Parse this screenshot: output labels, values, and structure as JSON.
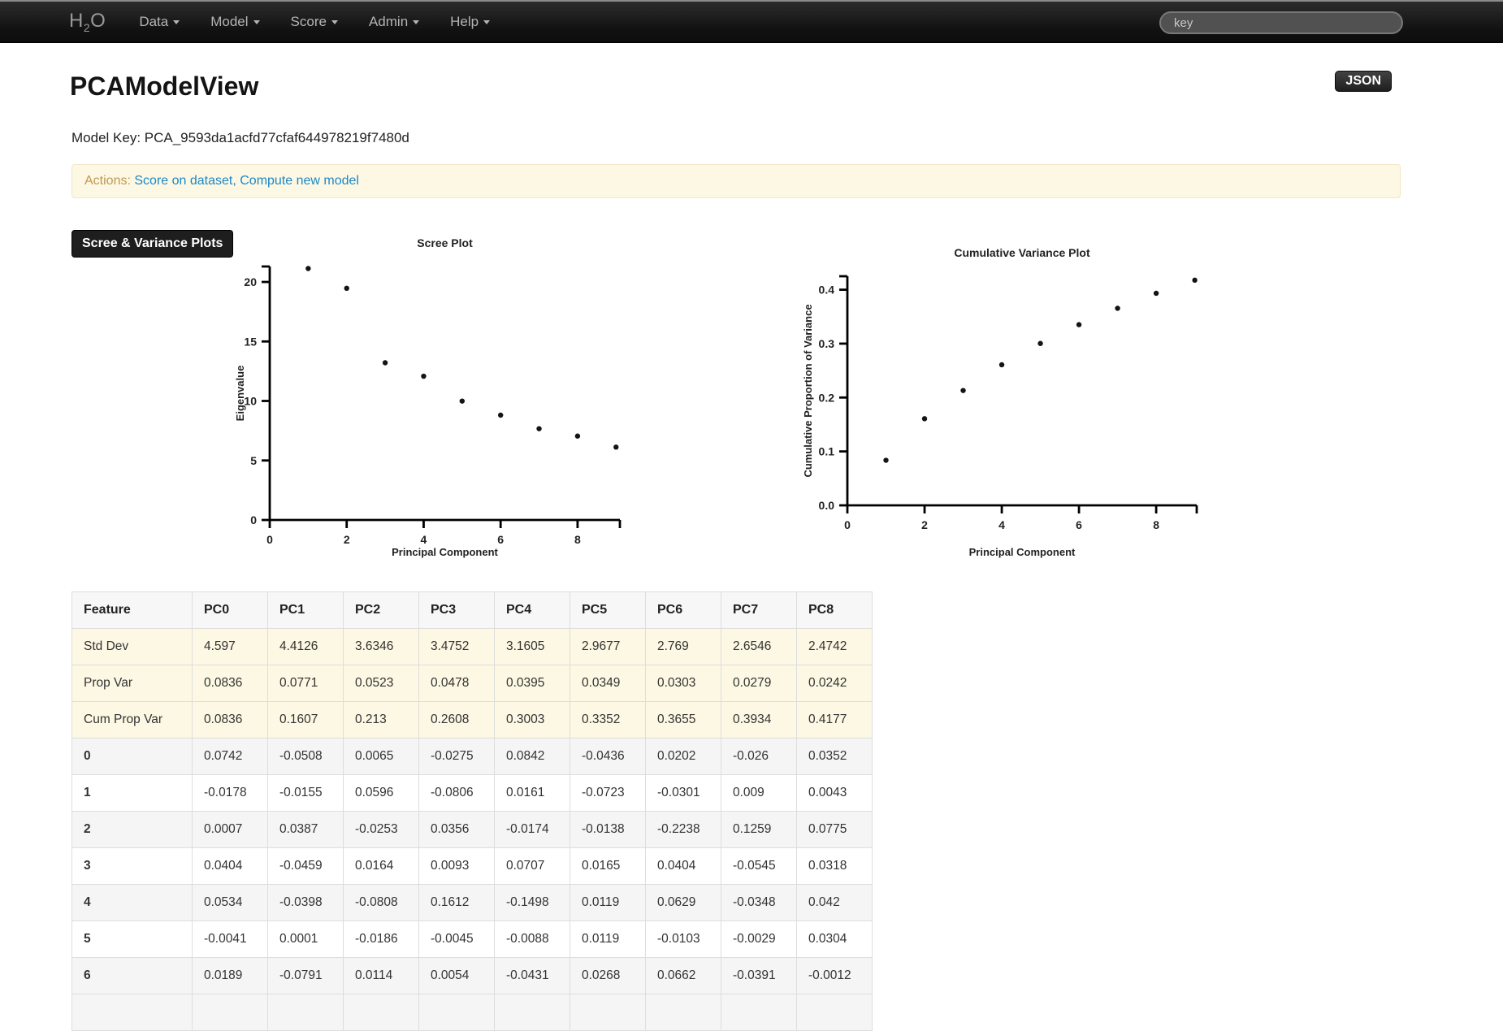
{
  "navbar": {
    "logo": {
      "prefix": "H",
      "sub": "2",
      "suffix": "O"
    },
    "items": [
      {
        "label": "Data"
      },
      {
        "label": "Model"
      },
      {
        "label": "Score"
      },
      {
        "label": "Admin"
      },
      {
        "label": "Help"
      }
    ],
    "search_placeholder": "key"
  },
  "page": {
    "title": "PCAModelView",
    "model_key_label": "Model Key: ",
    "model_key": "PCA_9593da1acfd77cfaf644978219f7480d",
    "json_button": "JSON",
    "actions_label": "Actions:",
    "actions": [
      {
        "label": "Score on dataset"
      },
      {
        "label": "Compute new model"
      }
    ],
    "actions_separator": ", ",
    "section_button": "Scree & Variance Plots"
  },
  "colors": {
    "accent_link": "#1e87c8",
    "alert_text": "#c09853",
    "alert_bg": "#fcf8e3",
    "warning_row_bg": "#fcf8e3",
    "stripe_row_bg": "#f5f5f5"
  },
  "chart_data": [
    {
      "type": "scatter",
      "title": "Scree Plot",
      "xlabel": "Principal Component",
      "ylabel": "Eigenvalue",
      "x": [
        1,
        2,
        3,
        4,
        5,
        6,
        7,
        8,
        9
      ],
      "y": [
        21.13,
        19.47,
        13.21,
        12.08,
        9.99,
        8.81,
        7.67,
        7.05,
        6.12
      ],
      "xlim": [
        0,
        9.1
      ],
      "ylim": [
        0,
        21.3
      ],
      "grid": false,
      "legend": "none",
      "xticks": [
        {
          "v": 0,
          "label": "0"
        },
        {
          "v": 2,
          "label": "2"
        },
        {
          "v": 4,
          "label": "4"
        },
        {
          "v": 6,
          "label": "6"
        },
        {
          "v": 8,
          "label": "8"
        }
      ],
      "yticks": [
        {
          "v": 0,
          "label": "0"
        },
        {
          "v": 5,
          "label": "5"
        },
        {
          "v": 10,
          "label": "10"
        },
        {
          "v": 15,
          "label": "15"
        },
        {
          "v": 20,
          "label": "20"
        }
      ]
    },
    {
      "type": "scatter",
      "title": "Cumulative Variance Plot",
      "xlabel": "Principal Component",
      "ylabel": "Cumulative Proportion of Variance",
      "x": [
        1,
        2,
        3,
        4,
        5,
        6,
        7,
        8,
        9
      ],
      "y": [
        0.0836,
        0.1607,
        0.213,
        0.2608,
        0.3003,
        0.3352,
        0.3655,
        0.3934,
        0.4177
      ],
      "xlim": [
        0,
        9.05
      ],
      "ylim": [
        0,
        0.425
      ],
      "grid": false,
      "legend": "none",
      "xticks": [
        {
          "v": 0,
          "label": "0"
        },
        {
          "v": 2,
          "label": "2"
        },
        {
          "v": 4,
          "label": "4"
        },
        {
          "v": 6,
          "label": "6"
        },
        {
          "v": 8,
          "label": "8"
        }
      ],
      "yticks": [
        {
          "v": 0,
          "label": "0.0"
        },
        {
          "v": 0.1,
          "label": "0.1"
        },
        {
          "v": 0.2,
          "label": "0.2"
        },
        {
          "v": 0.3,
          "label": "0.3"
        },
        {
          "v": 0.4,
          "label": "0.4"
        }
      ]
    }
  ],
  "table": {
    "columns": [
      "Feature",
      "PC0",
      "PC1",
      "PC2",
      "PC3",
      "PC4",
      "PC5",
      "PC6",
      "PC7",
      "PC8"
    ],
    "rows": [
      {
        "label": "Std Dev",
        "style": "warning",
        "values": [
          "4.597",
          "4.4126",
          "3.6346",
          "3.4752",
          "3.1605",
          "2.9677",
          "2.769",
          "2.6546",
          "2.4742"
        ]
      },
      {
        "label": "Prop Var",
        "style": "warning",
        "values": [
          "0.0836",
          "0.0771",
          "0.0523",
          "0.0478",
          "0.0395",
          "0.0349",
          "0.0303",
          "0.0279",
          "0.0242"
        ]
      },
      {
        "label": "Cum Prop Var",
        "style": "warning",
        "values": [
          "0.0836",
          "0.1607",
          "0.213",
          "0.2608",
          "0.3003",
          "0.3352",
          "0.3655",
          "0.3934",
          "0.4177"
        ]
      },
      {
        "label": "0",
        "style": "numeric",
        "values": [
          "0.0742",
          "-0.0508",
          "0.0065",
          "-0.0275",
          "0.0842",
          "-0.0436",
          "0.0202",
          "-0.026",
          "0.0352"
        ]
      },
      {
        "label": "1",
        "style": "numeric",
        "values": [
          "-0.0178",
          "-0.0155",
          "0.0596",
          "-0.0806",
          "0.0161",
          "-0.0723",
          "-0.0301",
          "0.009",
          "0.0043"
        ]
      },
      {
        "label": "2",
        "style": "numeric",
        "values": [
          "0.0007",
          "0.0387",
          "-0.0253",
          "0.0356",
          "-0.0174",
          "-0.0138",
          "-0.2238",
          "0.1259",
          "0.0775"
        ]
      },
      {
        "label": "3",
        "style": "numeric",
        "values": [
          "0.0404",
          "-0.0459",
          "0.0164",
          "0.0093",
          "0.0707",
          "0.0165",
          "0.0404",
          "-0.0545",
          "0.0318"
        ]
      },
      {
        "label": "4",
        "style": "numeric",
        "values": [
          "0.0534",
          "-0.0398",
          "-0.0808",
          "0.1612",
          "-0.1498",
          "0.0119",
          "0.0629",
          "-0.0348",
          "0.042"
        ]
      },
      {
        "label": "5",
        "style": "numeric",
        "values": [
          "-0.0041",
          "0.0001",
          "-0.0186",
          "-0.0045",
          "-0.0088",
          "0.0119",
          "-0.0103",
          "-0.0029",
          "0.0304"
        ]
      },
      {
        "label": "6",
        "style": "numeric",
        "values": [
          "0.0189",
          "-0.0791",
          "0.0114",
          "0.0054",
          "-0.0431",
          "0.0268",
          "0.0662",
          "-0.0391",
          "-0.0012"
        ]
      }
    ],
    "partial_row": true
  }
}
